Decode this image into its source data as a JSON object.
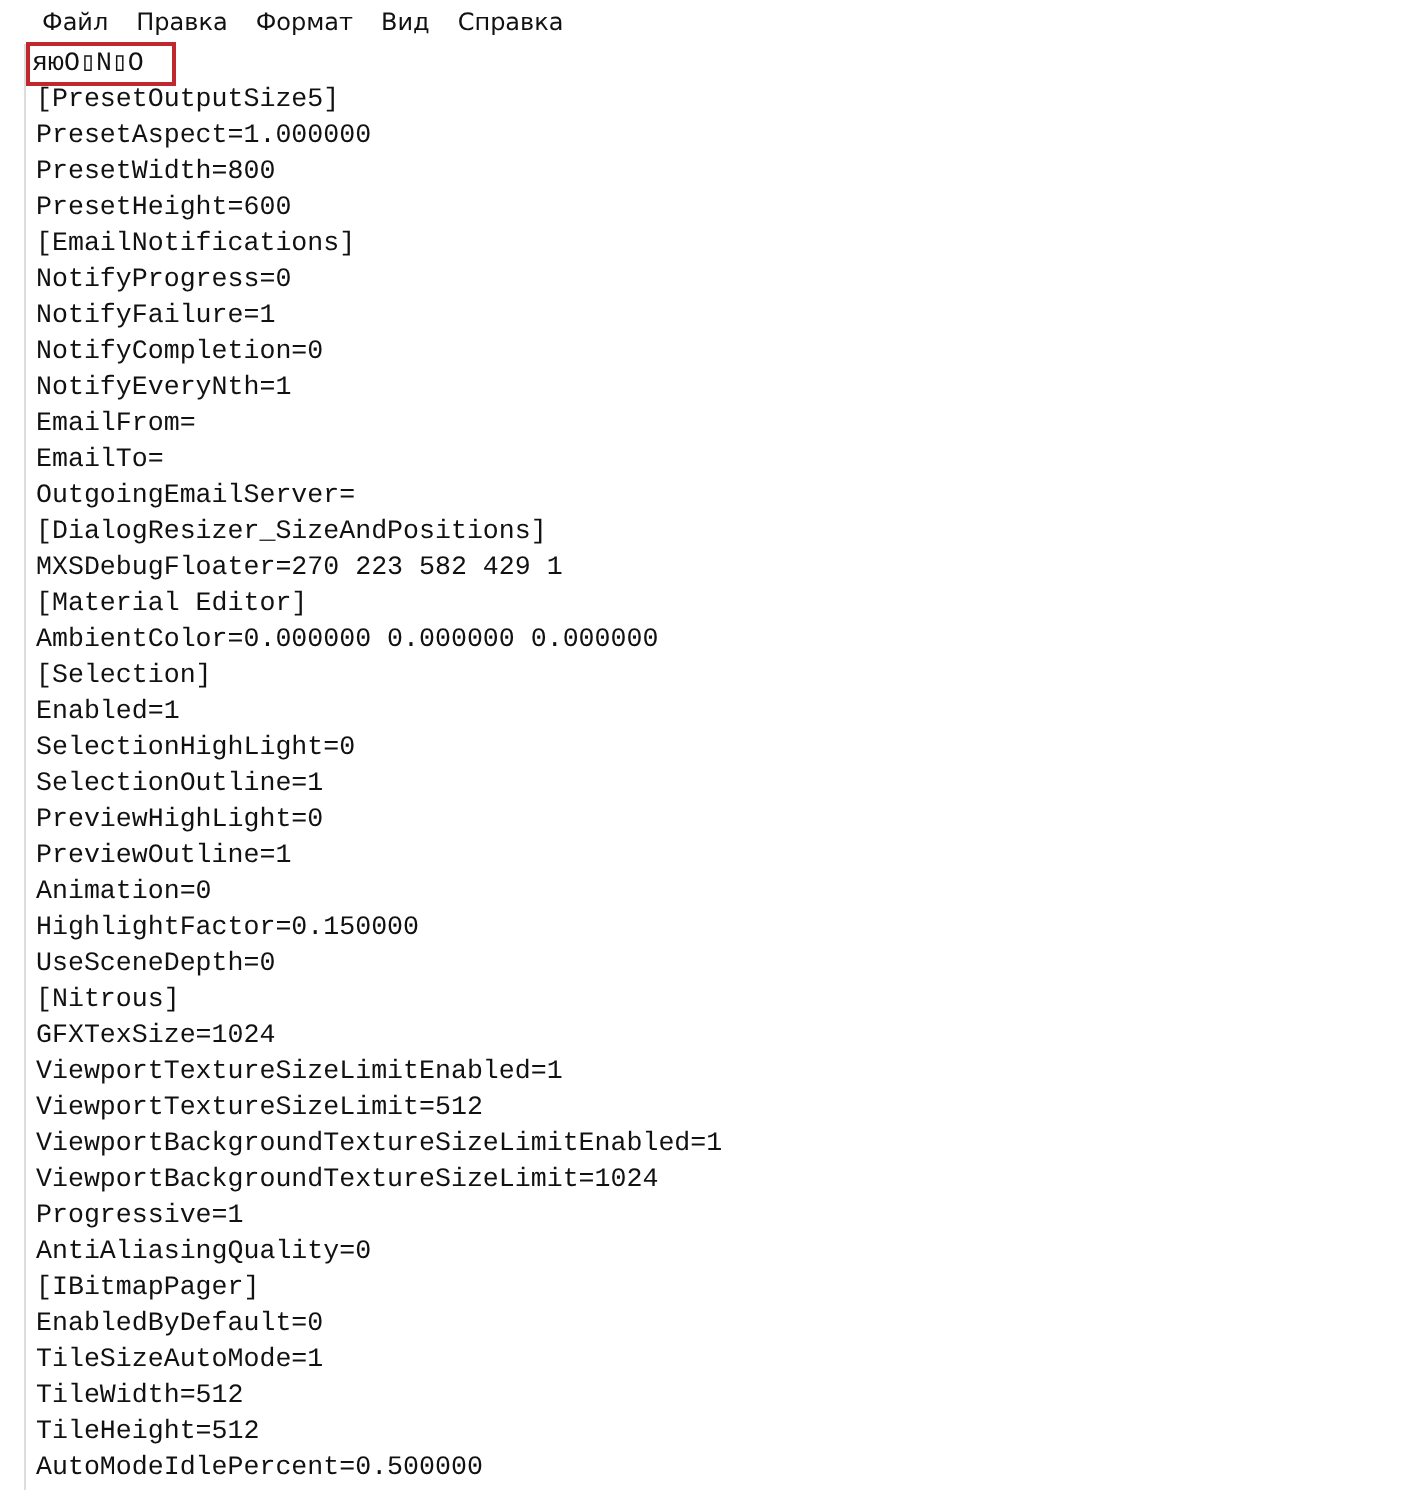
{
  "menu": [
    {
      "label": "Файл"
    },
    {
      "label": "Правка"
    },
    {
      "label": "Формат"
    },
    {
      "label": "Вид"
    },
    {
      "label": "Справка"
    }
  ],
  "lines": [
    {
      "text": "яюO▯N▯O",
      "highlighted": true
    },
    {
      "text": "[PresetOutputSize5]",
      "highlighted": false
    },
    {
      "text": "PresetAspect=1.000000",
      "highlighted": false
    },
    {
      "text": "PresetWidth=800",
      "highlighted": false
    },
    {
      "text": "PresetHeight=600",
      "highlighted": false
    },
    {
      "text": "[EmailNotifications]",
      "highlighted": false
    },
    {
      "text": "NotifyProgress=0",
      "highlighted": false
    },
    {
      "text": "NotifyFailure=1",
      "highlighted": false
    },
    {
      "text": "NotifyCompletion=0",
      "highlighted": false
    },
    {
      "text": "NotifyEveryNth=1",
      "highlighted": false
    },
    {
      "text": "EmailFrom=",
      "highlighted": false
    },
    {
      "text": "EmailTo=",
      "highlighted": false
    },
    {
      "text": "OutgoingEmailServer=",
      "highlighted": false
    },
    {
      "text": "[DialogResizer_SizeAndPositions]",
      "highlighted": false
    },
    {
      "text": "MXSDebugFloater=270 223 582 429 1",
      "highlighted": false
    },
    {
      "text": "[Material Editor]",
      "highlighted": false
    },
    {
      "text": "AmbientColor=0.000000 0.000000 0.000000",
      "highlighted": false
    },
    {
      "text": "[Selection]",
      "highlighted": false
    },
    {
      "text": "Enabled=1",
      "highlighted": false
    },
    {
      "text": "SelectionHighLight=0",
      "highlighted": false
    },
    {
      "text": "SelectionOutline=1",
      "highlighted": false
    },
    {
      "text": "PreviewHighLight=0",
      "highlighted": false
    },
    {
      "text": "PreviewOutline=1",
      "highlighted": false
    },
    {
      "text": "Animation=0",
      "highlighted": false
    },
    {
      "text": "HighlightFactor=0.150000",
      "highlighted": false
    },
    {
      "text": "UseSceneDepth=0",
      "highlighted": false
    },
    {
      "text": "[Nitrous]",
      "highlighted": false
    },
    {
      "text": "GFXTexSize=1024",
      "highlighted": false
    },
    {
      "text": "ViewportTextureSizeLimitEnabled=1",
      "highlighted": false
    },
    {
      "text": "ViewportTextureSizeLimit=512",
      "highlighted": false
    },
    {
      "text": "ViewportBackgroundTextureSizeLimitEnabled=1",
      "highlighted": false
    },
    {
      "text": "ViewportBackgroundTextureSizeLimit=1024",
      "highlighted": false
    },
    {
      "text": "Progressive=1",
      "highlighted": false
    },
    {
      "text": "AntiAliasingQuality=0",
      "highlighted": false
    },
    {
      "text": "[IBitmapPager]",
      "highlighted": false
    },
    {
      "text": "EnabledByDefault=0",
      "highlighted": false
    },
    {
      "text": "TileSizeAutoMode=1",
      "highlighted": false
    },
    {
      "text": "TileWidth=512",
      "highlighted": false
    },
    {
      "text": "TileHeight=512",
      "highlighted": false
    },
    {
      "text": "AutoModeIdlePercent=0.500000",
      "highlighted": false
    }
  ]
}
